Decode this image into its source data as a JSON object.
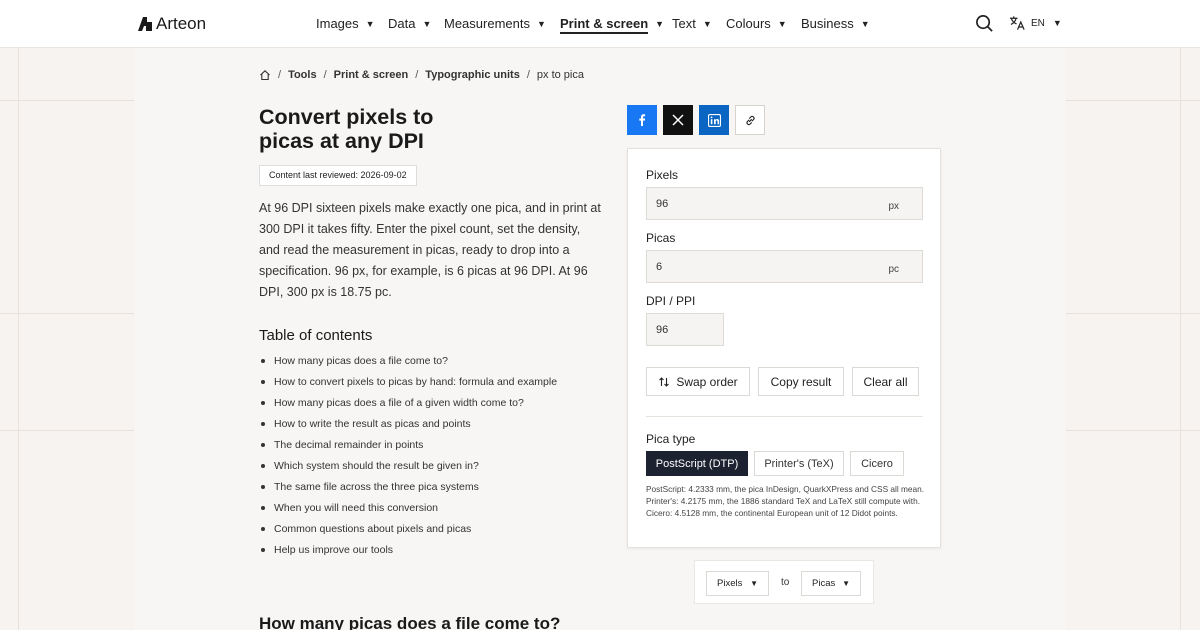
{
  "brand": {
    "name": "Arteon"
  },
  "nav": {
    "items": [
      {
        "label": "Images"
      },
      {
        "label": "Data"
      },
      {
        "label": "Measurements"
      },
      {
        "label": "Print & screen"
      },
      {
        "label": "Text"
      },
      {
        "label": "Colours"
      },
      {
        "label": "Business"
      }
    ],
    "active": "Print & screen",
    "lang": "EN"
  },
  "breadcrumb": [
    "Tools",
    "Print & screen",
    "Typographic units",
    "px to pica"
  ],
  "page": {
    "title_line1": "Convert pixels to",
    "title_line2": "picas at any DPI",
    "reviewed": "Content last reviewed: 2026-09-02",
    "intro": "At 96 DPI sixteen pixels make exactly one pica, and in print at 300 DPI it takes fifty. Enter the pixel count, set the density, and read the measurement in picas, ready to drop into a specification. 96 px, for example, is 6 picas at 96 DPI. At 96 DPI, 300 px is 18.75 pc.",
    "toc_title": "Table of contents",
    "toc": [
      "How many picas does a file come to?",
      "How to convert pixels to picas by hand: formula and example",
      "How many picas does a file of a given width come to?",
      "How to write the result as picas and points",
      "The decimal remainder in points",
      "Which system should the result be given in?",
      "The same file across the three pica systems",
      "When you will need this conversion",
      "Common questions about pixels and picas",
      "Help us improve our tools"
    ],
    "section_title": "How many picas does a file come to?"
  },
  "share": {
    "icons": [
      "facebook-icon",
      "x-icon",
      "linkedin-icon",
      "link-icon"
    ],
    "colors": {
      "facebook": "#1877f2",
      "x": "#111111",
      "linkedin": "#0a66c2"
    }
  },
  "converter": {
    "pixels_label": "Pixels",
    "pixels_value": "96",
    "pixels_unit": "px",
    "picas_label": "Picas",
    "picas_value": "6",
    "picas_unit": "pc",
    "dpi_label": "DPI / PPI",
    "dpi_value": "96",
    "swap": "Swap order",
    "copy": "Copy result",
    "clear": "Clear all",
    "pica_type_label": "Pica type",
    "pica_types": [
      "PostScript (DTP)",
      "Printer's (TeX)",
      "Cicero"
    ],
    "pica_type_selected": "PostScript (DTP)",
    "note": "PostScript: 4.2333 mm, the pica InDesign, QuarkXPress and CSS all mean. Printer's: 4.2175 mm, the 1886 standard TeX and LaTeX still compute with. Cicero: 4.5128 mm, the continental European unit of 12 Didot points."
  },
  "unit_switcher": {
    "from": "Pixels",
    "to_word": "to",
    "to": "Picas"
  },
  "colors": {
    "accent_dark": "#1c2230",
    "page_bg": "#f6f3f0"
  }
}
